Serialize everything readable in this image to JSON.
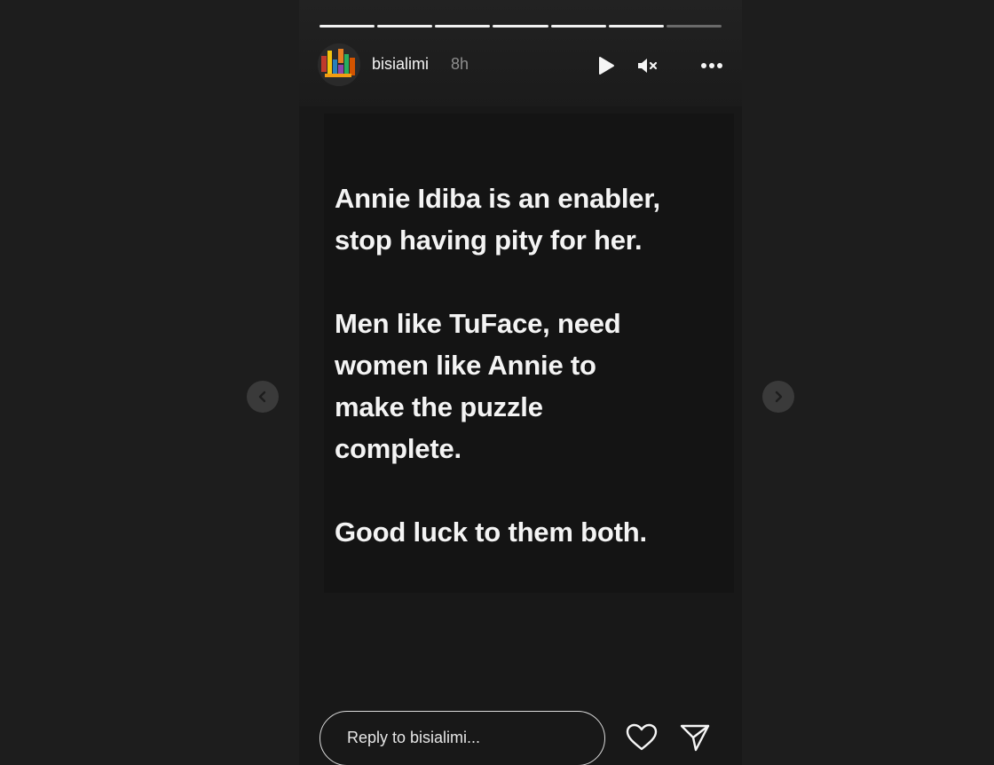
{
  "story": {
    "username": "bisialimi",
    "time_ago": "8h",
    "progress_segments": [
      {
        "state": "viewed"
      },
      {
        "state": "viewed"
      },
      {
        "state": "viewed"
      },
      {
        "state": "viewed"
      },
      {
        "state": "viewed"
      },
      {
        "state": "viewed"
      },
      {
        "state": "upcoming"
      }
    ],
    "paragraphs": [
      "Annie Idiba is an enabler,\nstop having pity for her.",
      "Men like TuFace, need\nwomen like Annie to\nmake the puzzle\ncomplete.",
      "Good luck to them both."
    ]
  },
  "controls": {
    "play_icon": "play-icon",
    "mute_icon": "muted-speaker-icon",
    "more_icon": "more-horizontal-icon"
  },
  "reply": {
    "placeholder": "Reply to bisialimi..."
  },
  "actions": {
    "like_icon": "heart-icon",
    "share_icon": "paper-plane-icon"
  },
  "navigation": {
    "prev_icon": "chevron-left-icon",
    "next_icon": "chevron-right-icon"
  },
  "colors": {
    "background": "#1d1d1d",
    "story_background": "#181818",
    "text": "#f4f4f4",
    "muted_text": "#8e8e8e"
  }
}
